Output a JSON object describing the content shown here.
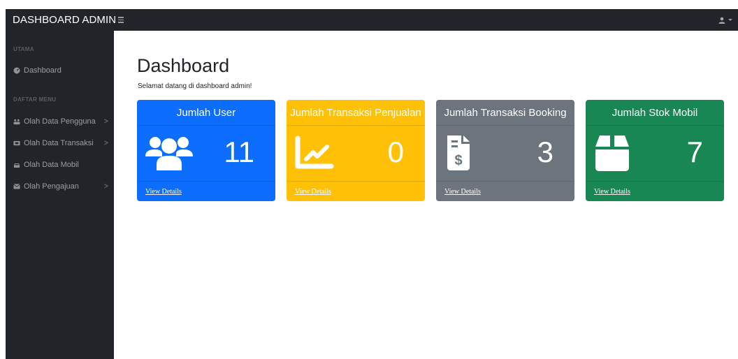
{
  "navbar": {
    "brand": "DASHBOARD ADMIN",
    "toggle_icon": "bars-icon",
    "user_icon": "user-icon"
  },
  "sidebar": {
    "sections": [
      {
        "heading": "UTAMA"
      },
      {
        "heading": "DAFTAR MENU"
      }
    ],
    "items": [
      {
        "label": "Dashboard",
        "icon": "dashboard-icon",
        "has_children": false
      },
      {
        "label": "Olah Data Pengguna",
        "icon": "users-icon",
        "has_children": true
      },
      {
        "label": "Olah Data Transaksi",
        "icon": "ticket-icon",
        "has_children": true
      },
      {
        "label": "Olah Data Mobil",
        "icon": "car-icon",
        "has_children": false
      },
      {
        "label": "Olah Pengajuan",
        "icon": "envelope-icon",
        "has_children": true
      }
    ],
    "chevron": ">"
  },
  "main": {
    "title": "Dashboard",
    "subtitle": "Selamat datang di dashboard admin!"
  },
  "cards": [
    {
      "title": "Jumlah User",
      "count": "11",
      "link": "View Details",
      "color": "#0d6efd",
      "icon": "users-icon"
    },
    {
      "title": "Jumlah Transaksi Penjualan",
      "count": "0",
      "link": "View Details",
      "color": "#ffc107",
      "icon": "chart-line-icon"
    },
    {
      "title": "Jumlah Transaksi Booking",
      "count": "3",
      "link": "View Details",
      "color": "#6c757d",
      "icon": "invoice-dollar-icon"
    },
    {
      "title": "Jumlah Stok Mobil",
      "count": "7",
      "link": "View Details",
      "color": "#198754",
      "icon": "box-icon"
    }
  ]
}
